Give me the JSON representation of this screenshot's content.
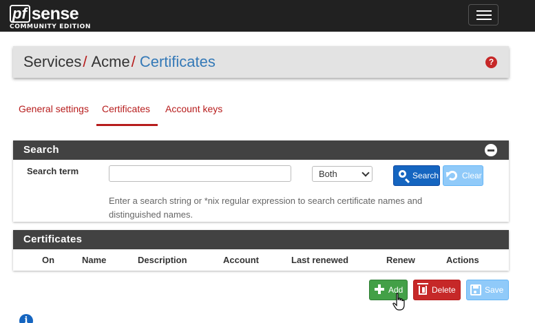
{
  "navbar": {
    "logo_pf": "pf",
    "logo_sense": "sense",
    "logo_edition": "COMMUNITY EDITION",
    "menu_icon": "hamburger-menu-icon"
  },
  "breadcrumb": {
    "items": [
      "Services",
      "Acme",
      "Certificates"
    ],
    "separator": "/",
    "help_icon": "question-circle-icon",
    "help_glyph": "?"
  },
  "tabs": [
    {
      "label": "General settings",
      "active": false
    },
    {
      "label": "Certificates",
      "active": true
    },
    {
      "label": "Account keys",
      "active": false
    }
  ],
  "search_panel": {
    "title": "Search",
    "collapse_icon": "minus-circle-icon",
    "term_label": "Search term",
    "input_value": "",
    "input_placeholder": "",
    "select_value": "Both",
    "search_button": "Search",
    "clear_button": "Clear",
    "help_text": "Enter a search string or *nix regular expression to search certificate names and distinguished names."
  },
  "cert_panel": {
    "title": "Certificates",
    "columns": [
      "On",
      "Name",
      "Description",
      "Account",
      "Last renewed",
      "Renew",
      "Actions"
    ],
    "rows": []
  },
  "actions": {
    "add": "Add",
    "delete": "Delete",
    "save": "Save"
  },
  "colors": {
    "navbar": "#212121",
    "accent_red": "#b71c1c",
    "link_blue": "#3479b7",
    "primary": "#1565c0",
    "success": "#43a047",
    "danger": "#c62828"
  }
}
